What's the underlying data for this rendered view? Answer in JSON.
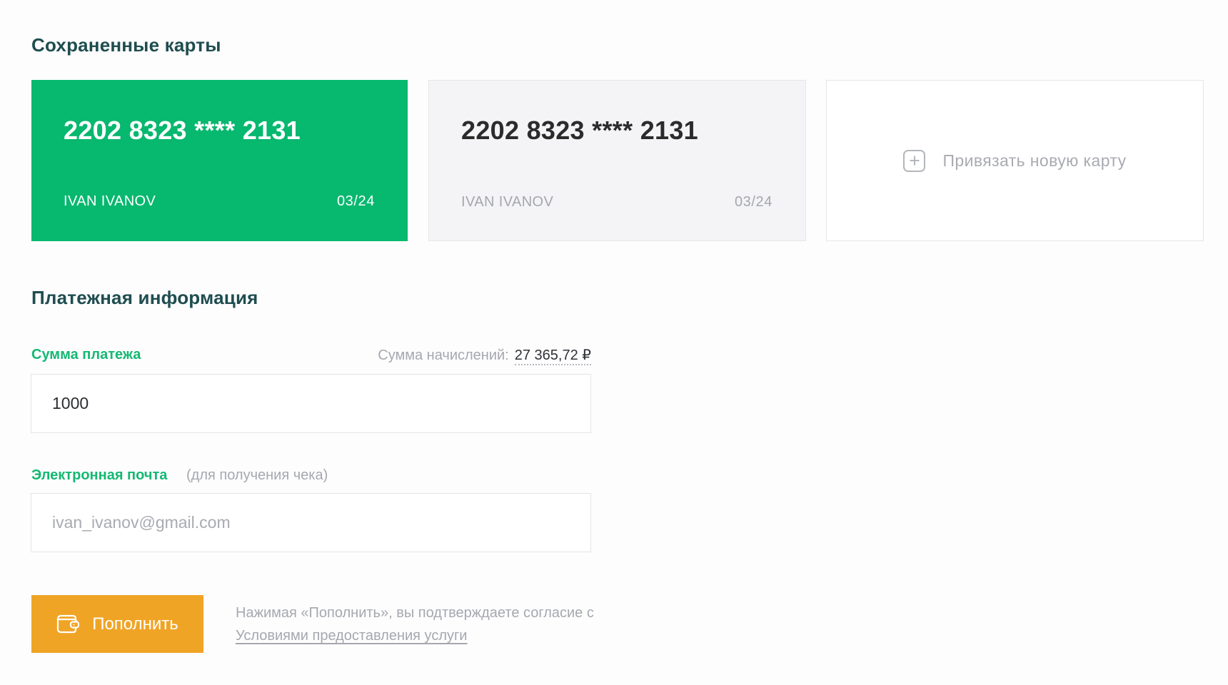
{
  "saved_cards": {
    "title": "Сохраненные карты",
    "cards": [
      {
        "number": "2202 8323 **** 2131",
        "holder": "IVAN IVANOV",
        "expiry": "03/24",
        "selected": true
      },
      {
        "number": "2202 8323 **** 2131",
        "holder": "IVAN IVANOV",
        "expiry": "03/24",
        "selected": false
      }
    ],
    "add_card_label": "Привязать новую карту"
  },
  "payment": {
    "title": "Платежная информация",
    "amount_label": "Сумма платежа",
    "accrual_label": "Сумма начислений:",
    "accrual_value": "27 365,72 ₽",
    "amount_value": "1000",
    "email_label": "Электронная почта",
    "email_hint": "(для получения чека)",
    "email_placeholder": "ivan_ivanov@gmail.com",
    "submit_label": "Пополнить",
    "consent_text": "Нажимая «Пополнить», вы подтверждаете согласие с ",
    "consent_link": "Условиями предоставления услуги"
  },
  "colors": {
    "accent_green": "#07b86f",
    "button_orange": "#f0a426",
    "title_dark": "#1f4d4f"
  },
  "icons": {
    "add_card": "plus-square-icon",
    "submit": "wallet-icon"
  }
}
